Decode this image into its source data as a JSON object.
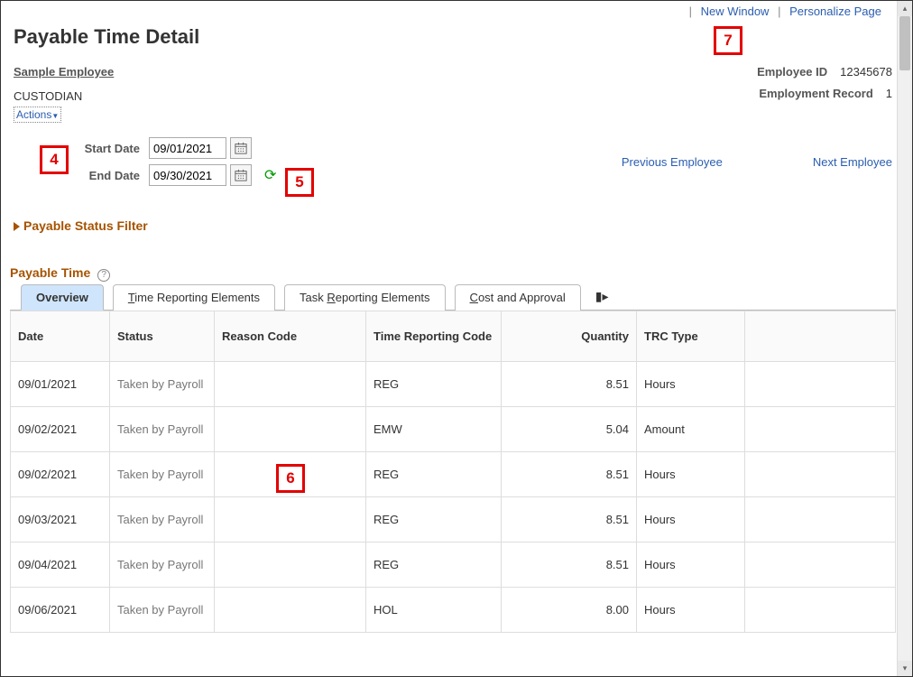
{
  "top_links": {
    "new_window": "New Window",
    "personalize": "Personalize Page"
  },
  "page_title": "Payable Time Detail",
  "employee": {
    "name": "Sample Employee",
    "job_title": "CUSTODIAN",
    "actions_label": "Actions",
    "id_label": "Employee ID",
    "id_value": "12345678",
    "record_label": "Employment Record",
    "record_value": "1"
  },
  "date_filter": {
    "start_label": "Start Date",
    "start_value": "09/01/2021",
    "end_label": "End Date",
    "end_value": "09/30/2021"
  },
  "nav": {
    "prev": "Previous Employee",
    "next": "Next Employee"
  },
  "status_filter_label": "Payable Status Filter",
  "grid_title": "Payable Time",
  "tabs": {
    "overview": "Overview",
    "time_elem_pre": "T",
    "time_elem_rest": "ime Reporting Elements",
    "task_elem_pre": "Task ",
    "task_elem_u": "R",
    "task_elem_rest": "eporting Elements",
    "cost_pre": "C",
    "cost_rest": "ost and Approval"
  },
  "columns": {
    "date": "Date",
    "status": "Status",
    "reason": "Reason Code",
    "trc": "Time Reporting Code",
    "qty": "Quantity",
    "trc_type": "TRC Type"
  },
  "rows": [
    {
      "date": "09/01/2021",
      "status": "Taken by Payroll",
      "reason": "",
      "trc": "REG",
      "qty": "8.51",
      "trc_type": "Hours"
    },
    {
      "date": "09/02/2021",
      "status": "Taken by Payroll",
      "reason": "",
      "trc": "EMW",
      "qty": "5.04",
      "trc_type": "Amount"
    },
    {
      "date": "09/02/2021",
      "status": "Taken by Payroll",
      "reason": "",
      "trc": "REG",
      "qty": "8.51",
      "trc_type": "Hours"
    },
    {
      "date": "09/03/2021",
      "status": "Taken by Payroll",
      "reason": "",
      "trc": "REG",
      "qty": "8.51",
      "trc_type": "Hours"
    },
    {
      "date": "09/04/2021",
      "status": "Taken by Payroll",
      "reason": "",
      "trc": "REG",
      "qty": "8.51",
      "trc_type": "Hours"
    },
    {
      "date": "09/06/2021",
      "status": "Taken by Payroll",
      "reason": "",
      "trc": "HOL",
      "qty": "8.00",
      "trc_type": "Hours"
    }
  ],
  "annotations": {
    "a4": "4",
    "a5": "5",
    "a6": "6",
    "a7": "7"
  }
}
